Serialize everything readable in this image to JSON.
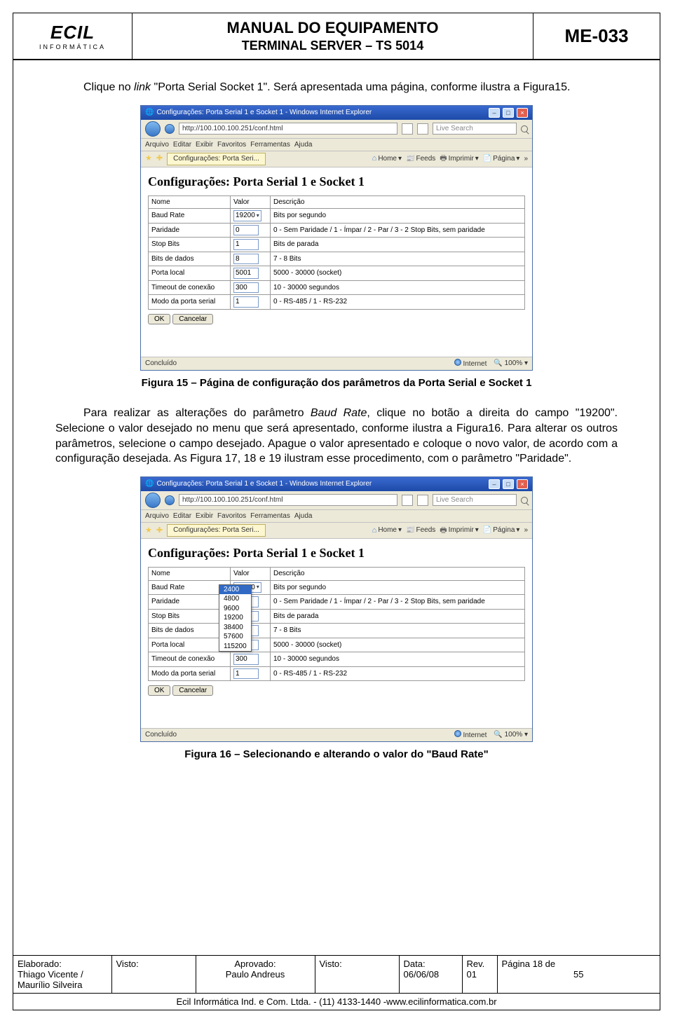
{
  "header": {
    "logo_brand": "ECIL",
    "logo_sub": "INFORMÁTICA",
    "title_main": "MANUAL DO EQUIPAMENTO",
    "title_sub": "TERMINAL SERVER – TS 5014",
    "doc_code": "ME-033"
  },
  "para1_a": "Clique no ",
  "para1_b": "link",
  "para1_c": " \"Porta Serial Socket 1\". Será apresentada uma página, conforme ilustra a Figura15.",
  "ie1": {
    "title": "Configurações: Porta Serial 1 e Socket 1 - Windows Internet Explorer",
    "url": "http://100.100.100.251/conf.html",
    "search_placeholder": "Live Search",
    "menus": [
      "Arquivo",
      "Editar",
      "Exibir",
      "Favoritos",
      "Ferramentas",
      "Ajuda"
    ],
    "tab": "Configurações: Porta Seri...",
    "tools": {
      "home": "Home",
      "feeds": "Feeds",
      "print": "Imprimir",
      "page": "Página"
    },
    "h1": "Configurações: Porta Serial 1 e Socket 1",
    "cols": [
      "Nome",
      "Valor",
      "Descrição"
    ],
    "rows": [
      {
        "n": "Baud Rate",
        "v": "19200",
        "d": "Bits por segundo",
        "sel": true
      },
      {
        "n": "Paridade",
        "v": "0",
        "d": "0 - Sem Paridade / 1 - Ímpar / 2 - Par / 3 - 2 Stop Bits, sem paridade"
      },
      {
        "n": "Stop Bits",
        "v": "1",
        "d": "Bits de parada"
      },
      {
        "n": "Bits de dados",
        "v": "8",
        "d": "7 - 8 Bits"
      },
      {
        "n": "Porta local",
        "v": "5001",
        "d": "5000 - 30000 (socket)"
      },
      {
        "n": "Timeout de conexão",
        "v": "300",
        "d": "10 - 30000 segundos"
      },
      {
        "n": "Modo da porta serial",
        "v": "1",
        "d": "0 - RS-485 / 1 - RS-232"
      }
    ],
    "ok": "OK",
    "cancel": "Cancelar",
    "status_left": "Concluído",
    "status_mid": "Internet",
    "status_zoom": "100%"
  },
  "caption1": "Figura 15 – Página de configuração dos parâmetros da Porta Serial e Socket 1",
  "para2_a": "Para realizar as alterações do parâmetro ",
  "para2_b": "Baud Rate",
  "para2_c": ", clique no botão a direita do campo \"19200\". Selecione o valor desejado no menu que será apresentado, conforme ilustra a Figura16. Para alterar os outros parâmetros, selecione o campo desejado. Apague o valor apresentado e coloque o novo valor, de acordo com a configuração desejada. As Figura 17, 18 e 19 ilustram esse procedimento, com o parâmetro \"Paridade\".",
  "ie2": {
    "dropdown": [
      "2400",
      "4800",
      "9600",
      "19200",
      "38400",
      "57600",
      "115200"
    ]
  },
  "caption2": "Figura 16 – Selecionando e alterando o valor do \"Baud Rate\"",
  "footer": {
    "c1_l1": "Elaborado:",
    "c1_l2": "Thiago Vicente /",
    "c1_l3": "Maurílio Silveira",
    "c2_l1": "Visto:",
    "c3_l1": "Aprovado:",
    "c3_l2": "Paulo Andreus",
    "c4_l1": "Visto:",
    "c5_l1": "Data:",
    "c5_l2": "06/06/08",
    "c6_l1": "Rev.",
    "c6_l2": "01",
    "c7_l1": "Página 18 de",
    "c7_l2": "55",
    "last": "Ecil Informática Ind. e Com. Ltda. - (11) 4133-1440 -www.ecilinformatica.com.br"
  }
}
